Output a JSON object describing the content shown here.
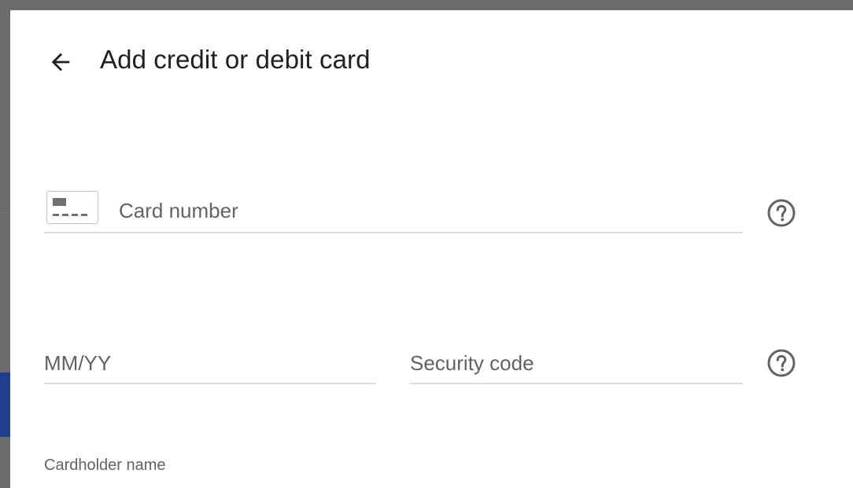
{
  "dialog": {
    "title": "Add credit or debit card",
    "back_icon": "arrow-left-icon"
  },
  "card_number": {
    "placeholder": "Card number",
    "value": "",
    "icon": "credit-card-icon",
    "help_icon": "help-circle-icon"
  },
  "expiry": {
    "placeholder": "MM/YY",
    "value": ""
  },
  "security_code": {
    "placeholder": "Security code",
    "value": "",
    "help_icon": "help-circle-icon"
  },
  "cardholder": {
    "label": "Cardholder name"
  },
  "colors": {
    "text_primary": "#202124",
    "text_secondary": "#5f6368",
    "underline": "#dadce0",
    "overlay": "#6b6b6b",
    "background_accent": "#1f3f8c"
  }
}
